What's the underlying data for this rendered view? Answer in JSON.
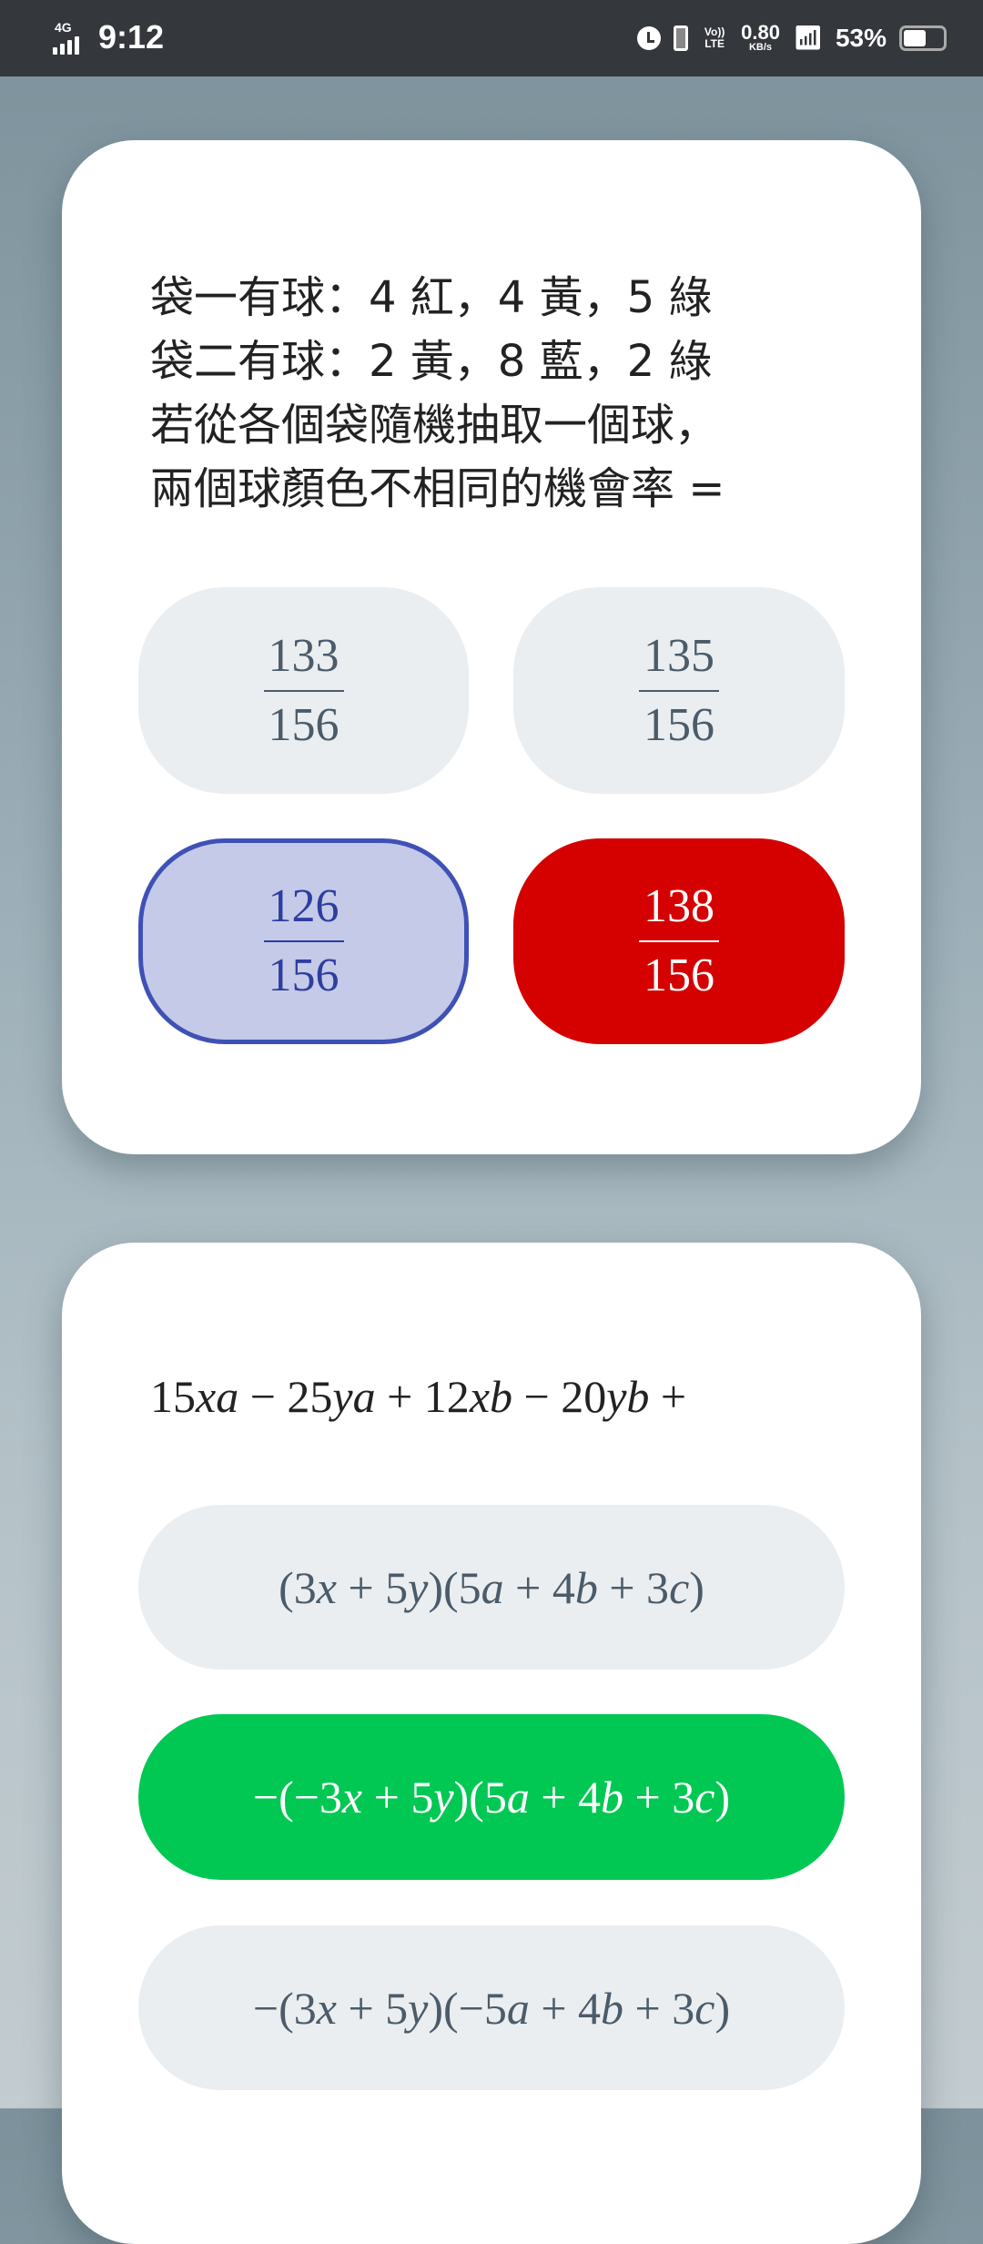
{
  "status_bar": {
    "network": "4G",
    "time": "9:12",
    "speed_value": "0.80",
    "speed_unit": "KB/s",
    "volte": "Vo)) LTE",
    "battery": "53%",
    "battery_level": 0.53
  },
  "question1": {
    "text": "袋一有球：4 紅，4 黃，5 綠\n袋二有球：2 黃，8 藍，2 綠\n若從各個袋隨機抽取一個球，\n兩個球顏色不相同的機會率 =",
    "options": [
      {
        "num": "133",
        "den": "156",
        "state": "default"
      },
      {
        "num": "135",
        "den": "156",
        "state": "default"
      },
      {
        "num": "126",
        "den": "156",
        "state": "selected"
      },
      {
        "num": "138",
        "den": "156",
        "state": "incorrect"
      }
    ]
  },
  "question2": {
    "text": "15xa − 25ya + 12xb − 20yb +",
    "options": [
      {
        "label": "(3x + 5y)(5a + 4b + 3c)",
        "state": "default"
      },
      {
        "label": "−(−3x + 5y)(5a + 4b + 3c)",
        "state": "correct"
      },
      {
        "label": "−(3x + 5y)(−5a + 4b + 3c)",
        "state": "default"
      }
    ]
  },
  "colors": {
    "selected": "#3f51b5",
    "incorrect": "#d50000",
    "correct": "#00c853",
    "option_bg": "#eaeef1"
  }
}
